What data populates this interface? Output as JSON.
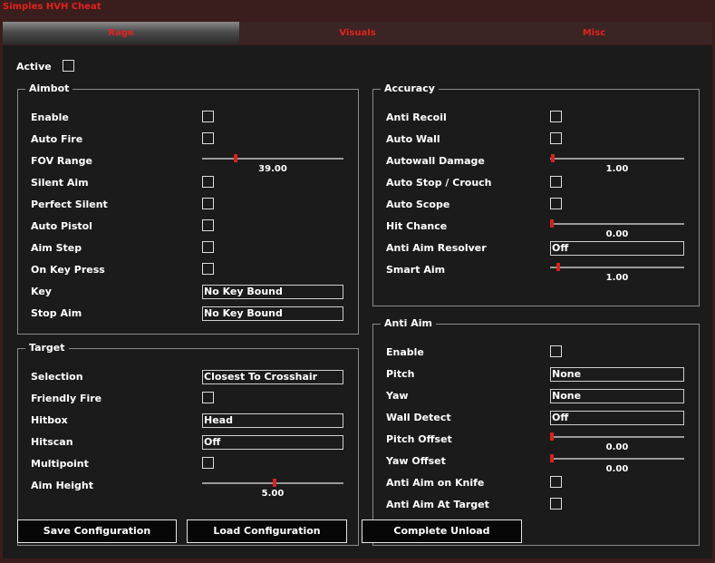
{
  "window": {
    "title": "Simples HVH Cheat"
  },
  "tabs": [
    {
      "label": "Rage"
    },
    {
      "label": "Visuals"
    },
    {
      "label": "Misc"
    }
  ],
  "active_label": "Active",
  "aimbot": {
    "title": "Aimbot",
    "enable": "Enable",
    "auto_fire": "Auto Fire",
    "fov_range": "FOV Range",
    "fov_value": "39.00",
    "fov_fraction": 0.23,
    "silent_aim": "Silent Aim",
    "perfect_silent": "Perfect Silent",
    "auto_pistol": "Auto Pistol",
    "aim_step": "Aim Step",
    "on_key_press": "On Key Press",
    "key": "Key",
    "key_value": "No Key Bound",
    "stop_aim": "Stop Aim",
    "stop_aim_value": "No Key Bound"
  },
  "target": {
    "title": "Target",
    "selection": "Selection",
    "selection_value": "Closest To Crosshair",
    "friendly_fire": "Friendly Fire",
    "hitbox": "Hitbox",
    "hitbox_value": "Head",
    "hitscan": "Hitscan",
    "hitscan_value": "Off",
    "multipoint": "Multipoint",
    "aim_height": "Aim Height",
    "aim_height_value": "5.00",
    "aim_height_fraction": 0.51
  },
  "accuracy": {
    "title": "Accuracy",
    "anti_recoil": "Anti Recoil",
    "auto_wall": "Auto Wall",
    "autowall_damage": "Autowall Damage",
    "autowall_damage_value": "1.00",
    "autowall_damage_fraction": 0.01,
    "auto_stop": "Auto Stop / Crouch",
    "auto_scope": "Auto Scope",
    "hit_chance": "Hit Chance",
    "hit_chance_value": "0.00",
    "hit_chance_fraction": 0.0,
    "anti_aim_resolver": "Anti Aim Resolver",
    "anti_aim_resolver_value": "Off",
    "smart_aim": "Smart Aim",
    "smart_aim_value": "1.00",
    "smart_aim_fraction": 0.05
  },
  "antiaim": {
    "title": "Anti Aim",
    "enable": "Enable",
    "pitch": "Pitch",
    "pitch_value": "None",
    "yaw": "Yaw",
    "yaw_value": "None",
    "wall_detect": "Wall Detect",
    "wall_detect_value": "Off",
    "pitch_offset": "Pitch Offset",
    "pitch_offset_value": "0.00",
    "pitch_offset_fraction": 0.0,
    "yaw_offset": "Yaw Offset",
    "yaw_offset_value": "0.00",
    "yaw_offset_fraction": 0.0,
    "on_knife": "Anti Aim on Knife",
    "at_target": "Anti Aim At Target"
  },
  "buttons": {
    "save": "Save Configuration",
    "load": "Load Configuration",
    "unload": "Complete Unload"
  },
  "colors": {
    "accent": "#e2221e",
    "background": "#1b1b1b",
    "frame": "#3a1d1d"
  }
}
